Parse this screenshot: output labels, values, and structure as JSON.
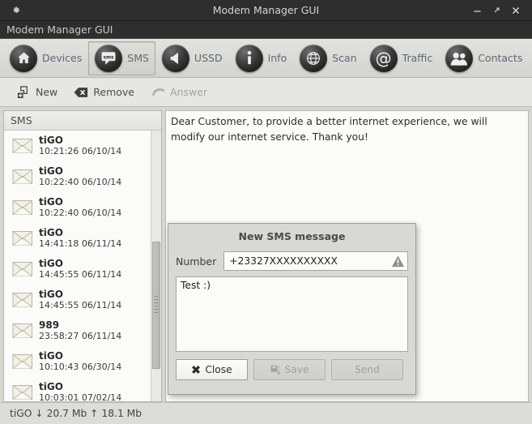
{
  "window": {
    "title": "Modem Manager GUI",
    "app_icon": "gear-icon",
    "menu_label": "Modem Manager GUI",
    "controls": {
      "minimize": "minimize-icon",
      "maximize": "maximize-icon",
      "close": "close-icon"
    }
  },
  "toolbar": {
    "items": [
      {
        "label": "Devices",
        "icon": "home-icon",
        "active": false
      },
      {
        "label": "SMS",
        "icon": "sms-icon",
        "active": true
      },
      {
        "label": "USSD",
        "icon": "ussd-icon",
        "active": false
      },
      {
        "label": "Info",
        "icon": "info-icon",
        "active": false
      },
      {
        "label": "Scan",
        "icon": "globe-icon",
        "active": false
      },
      {
        "label": "Traffic",
        "icon": "at-sign-icon",
        "active": false
      },
      {
        "label": "Contacts",
        "icon": "contacts-icon",
        "active": false
      }
    ]
  },
  "subtoolbar": {
    "items": [
      {
        "label": "New",
        "icon": "new-message-icon",
        "disabled": false
      },
      {
        "label": "Remove",
        "icon": "remove-message-icon",
        "disabled": false
      },
      {
        "label": "Answer",
        "icon": "reply-arrow-icon",
        "disabled": true
      }
    ]
  },
  "sidebar": {
    "header": "SMS",
    "messages": [
      {
        "sender": "tiGO",
        "timestamp": "10:21:26 06/10/14"
      },
      {
        "sender": "tiGO",
        "timestamp": "10:22:40 06/10/14"
      },
      {
        "sender": "tiGO",
        "timestamp": "10:22:40 06/10/14"
      },
      {
        "sender": "tiGO",
        "timestamp": "14:41:18 06/11/14"
      },
      {
        "sender": "tiGO",
        "timestamp": "14:45:55 06/11/14"
      },
      {
        "sender": "tiGO",
        "timestamp": "14:45:55 06/11/14"
      },
      {
        "sender": "989",
        "timestamp": "23:58:27 06/11/14"
      },
      {
        "sender": "tiGO",
        "timestamp": "10:10:43 06/30/14"
      },
      {
        "sender": "tiGO",
        "timestamp": "10:03:01 07/02/14"
      }
    ],
    "scrollbar": {
      "thumb_top_pct": 41,
      "thumb_height_pct": 47
    }
  },
  "content": {
    "message_text": "Dear Customer, to provide a better internet experience, we will modify our internet service. Thank you!"
  },
  "dialog": {
    "title": "New SMS message",
    "number_label": "Number",
    "number_value": "+23327XXXXXXXXXX",
    "number_warning_icon": "warning-icon",
    "message_value": "Test :)",
    "buttons": [
      {
        "label": "Close",
        "icon": "cancel-x-icon",
        "disabled": false
      },
      {
        "label": "Save",
        "icon": "save-disk-icon",
        "disabled": true
      },
      {
        "label": "Send",
        "icon": "",
        "disabled": true
      }
    ]
  },
  "statusbar": {
    "text": "tiGO ↓ 20.7 Mb ↑ 18.1 Mb"
  },
  "colors": {
    "titlebar_bg": "#2e2e2e",
    "toolbar_label": "#5e6a72",
    "window_bg": "#d6d6d2",
    "panel_bg": "#fbfbfa"
  }
}
